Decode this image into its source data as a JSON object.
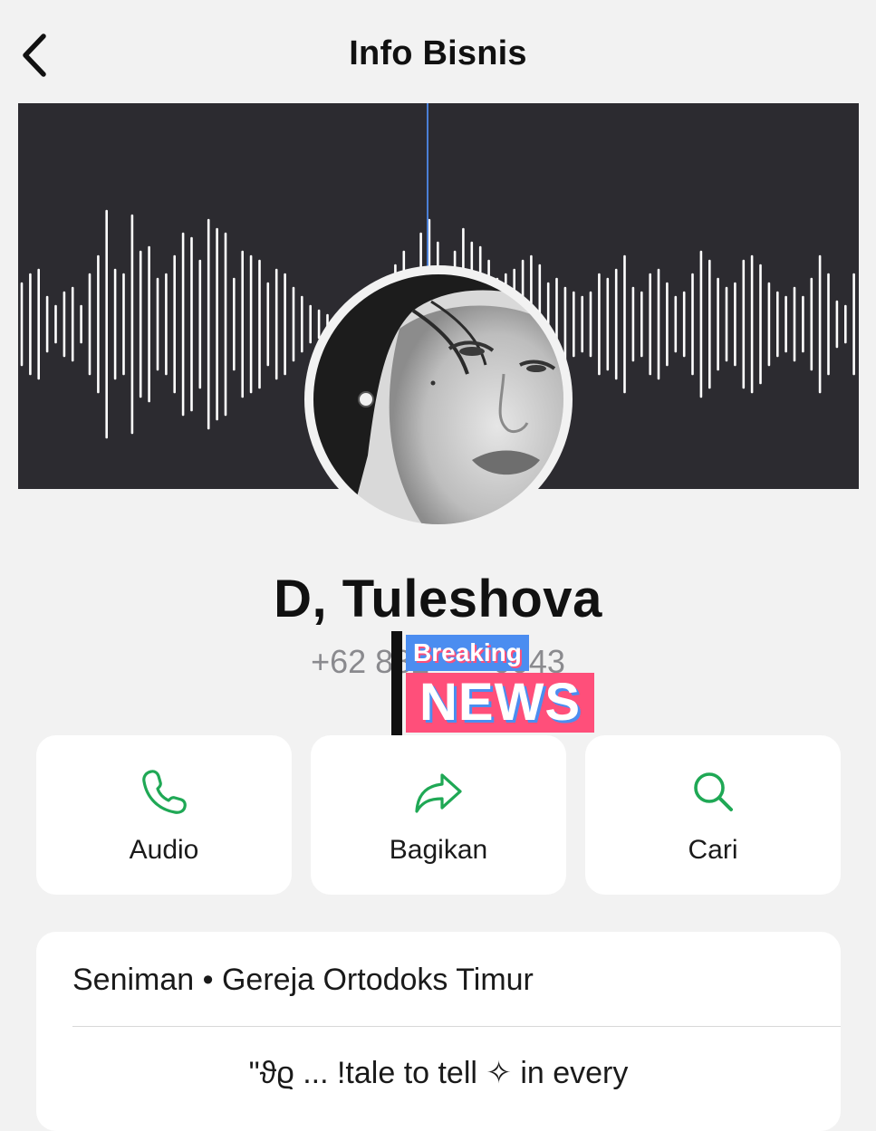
{
  "header": {
    "title": "Info Bisnis",
    "back_icon": "chevron-left-icon"
  },
  "profile": {
    "name": "D, Tuleshova",
    "phone": "+62 882-        0043"
  },
  "sticker": {
    "line1": "Breaking",
    "line2": "NEWS"
  },
  "actions": [
    {
      "label": "Audio",
      "icon": "phone-icon"
    },
    {
      "label": "Bagikan",
      "icon": "share-arrow-icon"
    },
    {
      "label": "Cari",
      "icon": "search-icon"
    }
  ],
  "info": {
    "category": "Seniman • Gereja Ortodoks Timur",
    "bio": "\"ϑϱ ... !tale to tell ✧ in every"
  },
  "colors": {
    "accent": "#1fa855",
    "background": "#f2f2f2",
    "cover": "#2c2b30",
    "sticker_blue": "#4b8df0",
    "sticker_pink": "#ff4f7a"
  }
}
